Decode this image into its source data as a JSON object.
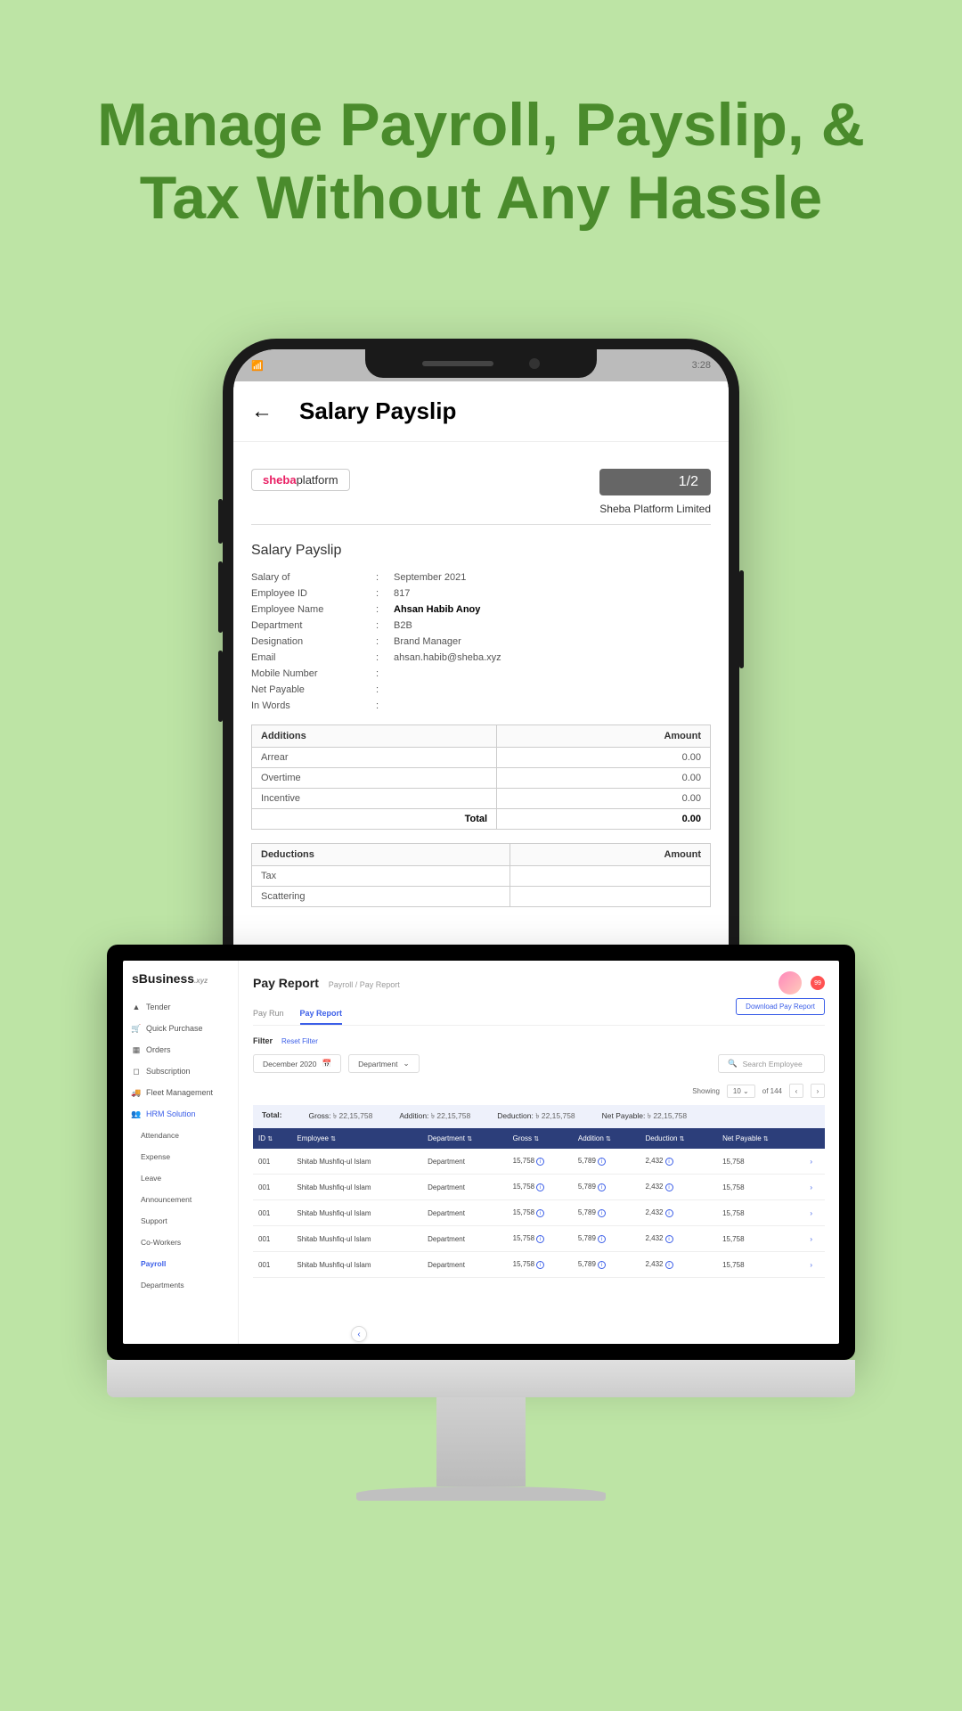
{
  "headline": "Manage Payroll, Payslip, & Tax Without Any Hassle",
  "phone": {
    "status_time": "3:28",
    "header_title": "Salary Payslip",
    "page_badge": "1/2",
    "logo": {
      "s": "sheba",
      "p": "platform"
    },
    "company": "Sheba Platform Limited",
    "section_title": "Salary Payslip",
    "info": [
      {
        "label": "Salary of",
        "value": "September 2021"
      },
      {
        "label": "Employee ID",
        "value": "817"
      },
      {
        "label": "Employee Name",
        "value": "Ahsan Habib Anoy",
        "bold": true
      },
      {
        "label": "Department",
        "value": "B2B"
      },
      {
        "label": "Designation",
        "value": "Brand Manager"
      },
      {
        "label": "Email",
        "value": "ahsan.habib@sheba.xyz"
      },
      {
        "label": "Mobile Number",
        "value": ""
      },
      {
        "label": "Net Payable",
        "value": ""
      },
      {
        "label": "In Words",
        "value": ""
      }
    ],
    "additions": {
      "header_left": "Additions",
      "header_right": "Amount",
      "rows": [
        {
          "label": "Arrear",
          "value": "0.00"
        },
        {
          "label": "Overtime",
          "value": "0.00"
        },
        {
          "label": "Incentive",
          "value": "0.00"
        }
      ],
      "total_label": "Total",
      "total_value": "0.00"
    },
    "deductions": {
      "header_left": "Deductions",
      "header_right": "Amount",
      "rows": [
        {
          "label": "Tax",
          "value": ""
        },
        {
          "label": "Scattering",
          "value": ""
        }
      ]
    }
  },
  "desktop": {
    "brand_main": "sBusiness",
    "brand_suffix": ".xyz",
    "nav": [
      {
        "icon": "▲",
        "label": "Tender"
      },
      {
        "icon": "🛒",
        "label": "Quick Purchase"
      },
      {
        "icon": "▦",
        "label": "Orders"
      },
      {
        "icon": "◻",
        "label": "Subscription"
      },
      {
        "icon": "🚚",
        "label": "Fleet Management"
      },
      {
        "icon": "👥",
        "label": "HRM Solution",
        "active": true
      }
    ],
    "subnav": [
      {
        "label": "Attendance"
      },
      {
        "label": "Expense"
      },
      {
        "label": "Leave"
      },
      {
        "label": "Announcement"
      },
      {
        "label": "Support"
      },
      {
        "label": "Co-Workers"
      },
      {
        "label": "Payroll",
        "active": true
      },
      {
        "label": "Departments"
      }
    ],
    "page_title": "Pay Report",
    "breadcrumb": "Payroll / Pay Report",
    "notif_count": "99",
    "tabs": [
      {
        "label": "Pay Run"
      },
      {
        "label": "Pay Report",
        "active": true
      }
    ],
    "download_btn": "Download Pay Report",
    "filter_label": "Filter",
    "reset_filter": "Reset Filter",
    "month_select": "December 2020",
    "dept_select": "Department",
    "search_placeholder": "Search Employee",
    "pagination": {
      "showing": "Showing",
      "per_page": "10",
      "of_text": "of 144"
    },
    "totals": {
      "label": "Total:",
      "gross_label": "Gross:",
      "gross_value": "৳ 22,15,758",
      "addition_label": "Addition:",
      "addition_value": "৳ 22,15,758",
      "deduction_label": "Deduction:",
      "deduction_value": "৳ 22,15,758",
      "net_label": "Net Payable:",
      "net_value": "৳ 22,15,758"
    },
    "columns": [
      "ID",
      "Employee",
      "Department",
      "Gross",
      "Addition",
      "Deduction",
      "Net Payable"
    ],
    "rows": [
      {
        "id": "001",
        "emp": "Shitab Mushfiq-ul Islam",
        "dept": "Department",
        "gross": "15,758",
        "add": "5,789",
        "ded": "2,432",
        "net": "15,758"
      },
      {
        "id": "001",
        "emp": "Shitab Mushfiq-ul Islam",
        "dept": "Department",
        "gross": "15,758",
        "add": "5,789",
        "ded": "2,432",
        "net": "15,758"
      },
      {
        "id": "001",
        "emp": "Shitab Mushfiq-ul Islam",
        "dept": "Department",
        "gross": "15,758",
        "add": "5,789",
        "ded": "2,432",
        "net": "15,758"
      },
      {
        "id": "001",
        "emp": "Shitab Mushfiq-ul Islam",
        "dept": "Department",
        "gross": "15,758",
        "add": "5,789",
        "ded": "2,432",
        "net": "15,758"
      },
      {
        "id": "001",
        "emp": "Shitab Mushfiq-ul Islam",
        "dept": "Department",
        "gross": "15,758",
        "add": "5,789",
        "ded": "2,432",
        "net": "15,758"
      }
    ]
  }
}
